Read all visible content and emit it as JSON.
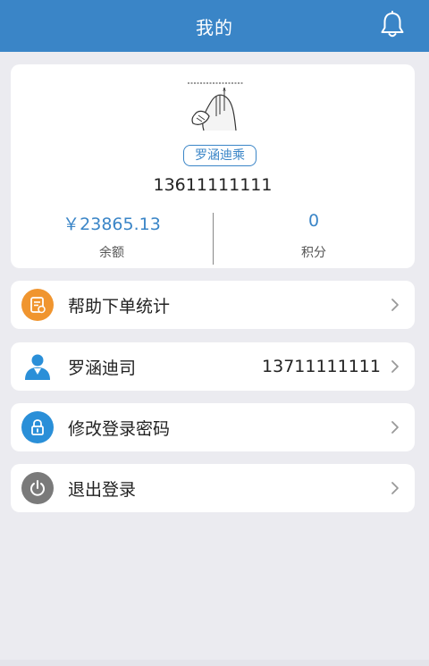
{
  "header": {
    "title": "我的"
  },
  "profile": {
    "nickname": "罗涵迪乘",
    "phone": "13611111111",
    "balance": {
      "value": "￥23865.13",
      "label": "余额"
    },
    "points": {
      "value": "0",
      "label": "积分"
    }
  },
  "menu": [
    {
      "label": "帮助下单统计",
      "icon": "order-stats-icon",
      "color": "#f0952f"
    },
    {
      "label": "罗涵迪司",
      "value": "13711111111",
      "icon": "driver-user-icon",
      "color": "#2a8fd8"
    },
    {
      "label": "修改登录密码",
      "icon": "lock-icon",
      "color": "#2a8fd8"
    },
    {
      "label": "退出登录",
      "icon": "power-icon",
      "color": "#7a7a7a"
    }
  ],
  "colors": {
    "brand": "#3a85c7",
    "background": "#ebebf0"
  }
}
